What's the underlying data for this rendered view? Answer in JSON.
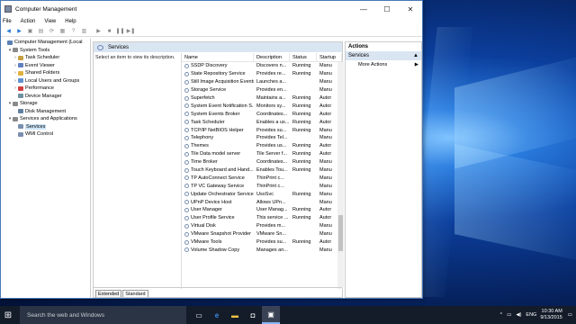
{
  "window": {
    "title": "Computer Management",
    "controls": {
      "minimize": "—",
      "maximize": "☐",
      "close": "✕"
    },
    "menu": [
      "File",
      "Action",
      "View",
      "Help"
    ]
  },
  "tree": [
    {
      "label": "Computer Management (Local",
      "indent": 0,
      "expander": "",
      "color": "#5b7fb5"
    },
    {
      "label": "System Tools",
      "indent": 1,
      "expander": "▾",
      "color": "#8a8a8a"
    },
    {
      "label": "Task Scheduler",
      "indent": 2,
      "expander": "›",
      "color": "#c8a040"
    },
    {
      "label": "Event Viewer",
      "indent": 2,
      "expander": "›",
      "color": "#6080c0"
    },
    {
      "label": "Shared Folders",
      "indent": 2,
      "expander": "›",
      "color": "#e0b040"
    },
    {
      "label": "Local Users and Groups",
      "indent": 2,
      "expander": "›",
      "color": "#6090d0"
    },
    {
      "label": "Performance",
      "indent": 2,
      "expander": "›",
      "color": "#d04040"
    },
    {
      "label": "Device Manager",
      "indent": 2,
      "expander": "",
      "color": "#7090a0"
    },
    {
      "label": "Storage",
      "indent": 1,
      "expander": "▾",
      "color": "#8a8a8a"
    },
    {
      "label": "Disk Management",
      "indent": 2,
      "expander": "",
      "color": "#6080a0"
    },
    {
      "label": "Services and Applications",
      "indent": 1,
      "expander": "▾",
      "color": "#8a8a8a"
    },
    {
      "label": "Services",
      "indent": 2,
      "expander": "",
      "color": "#7a8fb0",
      "selected": true
    },
    {
      "label": "WMI Control",
      "indent": 2,
      "expander": "",
      "color": "#7a8fb0"
    }
  ],
  "middle": {
    "header": "Services",
    "description_prompt": "Select an item to view its description.",
    "columns": [
      "Name",
      "Description",
      "Status",
      "Startup"
    ],
    "rows": [
      [
        "SSDP Discovery",
        "Discovers n...",
        "Running",
        "Manu"
      ],
      [
        "State Repository Service",
        "Provides re...",
        "Running",
        "Manu"
      ],
      [
        "Still Image Acquisition Events",
        "Launches a...",
        "",
        "Manu"
      ],
      [
        "Storage Service",
        "Provides en...",
        "",
        "Manu"
      ],
      [
        "Superfetch",
        "Maintains a...",
        "Running",
        "Autor"
      ],
      [
        "System Event Notification S...",
        "Monitors sy...",
        "Running",
        "Autor"
      ],
      [
        "System Events Broker",
        "Coordinates...",
        "Running",
        "Autor"
      ],
      [
        "Task Scheduler",
        "Enables a us...",
        "Running",
        "Autor"
      ],
      [
        "TCP/IP NetBIOS Helper",
        "Provides su...",
        "Running",
        "Manu"
      ],
      [
        "Telephony",
        "Provides Tel...",
        "",
        "Manu"
      ],
      [
        "Themes",
        "Provides us...",
        "Running",
        "Autor"
      ],
      [
        "Tile Data model server",
        "Tile Server f...",
        "Running",
        "Autor"
      ],
      [
        "Time Broker",
        "Coordinates...",
        "Running",
        "Manu"
      ],
      [
        "Touch Keyboard and Hand...",
        "Enables Tou...",
        "Running",
        "Manu"
      ],
      [
        "TP AutoConnect Service",
        "ThinPrint c...",
        "",
        "Manu"
      ],
      [
        "TP VC Gateway Service",
        "ThinPrint c...",
        "",
        "Manu"
      ],
      [
        "Update Orchestrator Service",
        "UsoSvc",
        "Running",
        "Manu"
      ],
      [
        "UPnP Device Host",
        "Allows UPn...",
        "",
        "Manu"
      ],
      [
        "User Manager",
        "User Manag...",
        "Running",
        "Autor"
      ],
      [
        "User Profile Service",
        "This service ...",
        "Running",
        "Autor"
      ],
      [
        "Virtual Disk",
        "Provides m...",
        "",
        "Manu"
      ],
      [
        "VMware Snapshot Provider",
        "VMware Sn...",
        "",
        "Manu"
      ],
      [
        "VMware Tools",
        "Provides su...",
        "Running",
        "Autor"
      ],
      [
        "Volume Shadow Copy",
        "Manages an...",
        "",
        "Manu"
      ]
    ],
    "tabs": [
      "Extended",
      "Standard"
    ]
  },
  "actions": {
    "header": "Actions",
    "section": "Services",
    "item": "More Actions",
    "section_arrow": "▲",
    "item_arrow": "▶"
  },
  "taskbar": {
    "search_placeholder": "Search the web and Windows",
    "language": "ENG",
    "time": "10:30 AM",
    "date": "9/13/2015"
  }
}
